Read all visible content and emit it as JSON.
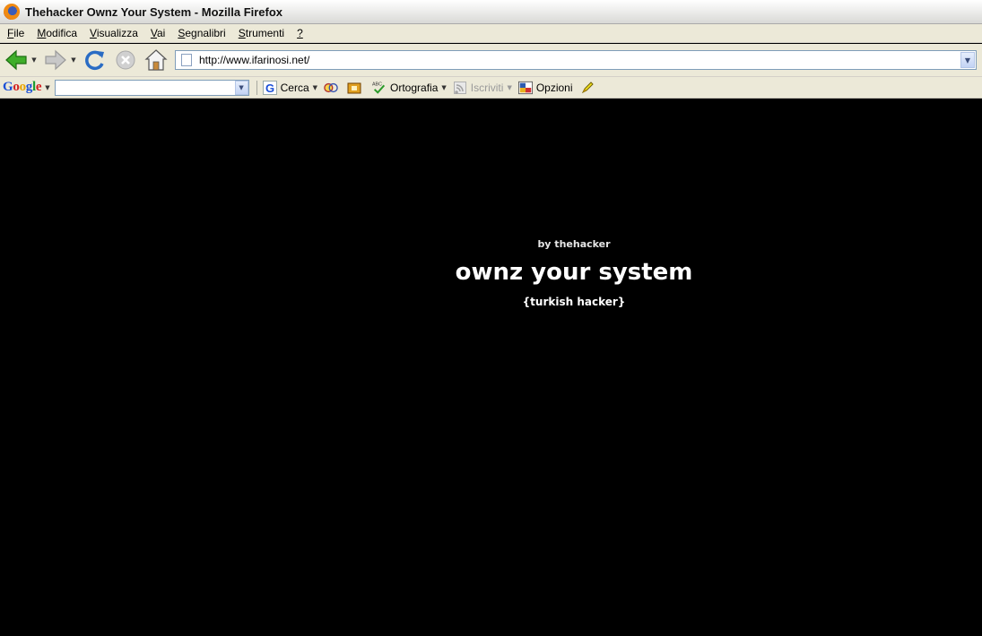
{
  "window": {
    "title": "Thehacker Ownz Your System - Mozilla Firefox"
  },
  "menu": {
    "items": [
      {
        "label": "File",
        "underline": "F",
        "rest": "ile"
      },
      {
        "label": "Modifica",
        "underline": "M",
        "rest": "odifica"
      },
      {
        "label": "Visualizza",
        "underline": "V",
        "rest": "isualizza"
      },
      {
        "label": "Vai",
        "underline": "V",
        "rest": "ai"
      },
      {
        "label": "Segnalibri",
        "underline": "S",
        "rest": "egnalibri"
      },
      {
        "label": "Strumenti",
        "underline": "S",
        "rest": "trumenti"
      },
      {
        "label": "?",
        "underline": "?",
        "rest": ""
      }
    ]
  },
  "navigation": {
    "url": "http://www.ifarinosi.net/",
    "icons": [
      "back-arrow-icon",
      "forward-arrow-icon",
      "reload-icon",
      "stop-icon",
      "home-icon"
    ]
  },
  "google_toolbar": {
    "logo": {
      "G": "G",
      "o1": "o",
      "o2": "o",
      "g": "g",
      "l": "l",
      "e": "e"
    },
    "search_value": "",
    "cerca_label": "Cerca",
    "ortografia_label": "Ortografia",
    "iscriviti_label": "Iscriviti",
    "opzioni_label": "Opzioni",
    "spell_badge": "ABC"
  },
  "page": {
    "byline": "by thehacker",
    "headline": "ownz your system",
    "subline": "{turkish hacker}"
  },
  "colors": {
    "page_background": "#000000",
    "page_text": "#ffffff",
    "chrome": "#ece9d8"
  }
}
